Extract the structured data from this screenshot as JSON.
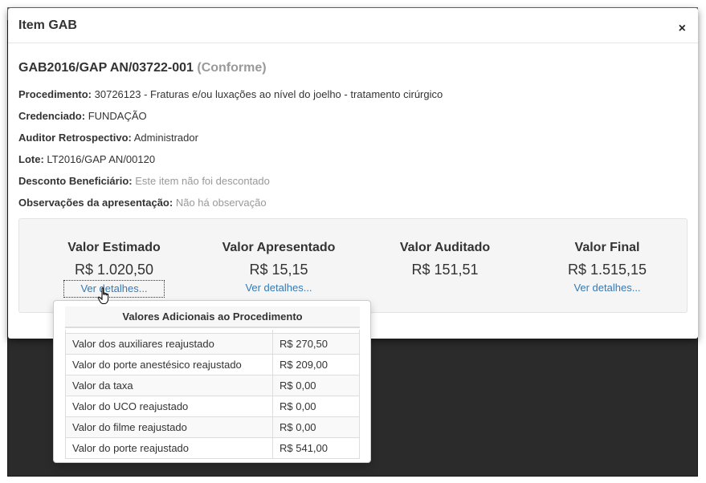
{
  "modal": {
    "title": "Item GAB",
    "close_glyph": "×"
  },
  "item": {
    "code": "GAB2016/GAP AN/03722-001",
    "status": "(Conforme)"
  },
  "fields": [
    {
      "label": "Procedimento:",
      "value": "30726123 - Fraturas e/ou luxações ao nível do joelho - tratamento cirúrgico",
      "muted": false
    },
    {
      "label": "Credenciado:",
      "value": "FUNDAÇÃO",
      "muted": false
    },
    {
      "label": "Auditor Retrospectivo:",
      "value": "Administrador",
      "muted": false
    },
    {
      "label": "Lote:",
      "value": "LT2016/GAP AN/00120",
      "muted": false
    },
    {
      "label": "Desconto Beneficiário:",
      "value": "Este item não foi descontado",
      "muted": true
    },
    {
      "label": "Observações da apresentação:",
      "value": "Não há observação",
      "muted": true
    }
  ],
  "values": [
    {
      "label": "Valor Estimado",
      "amount": "R$ 1.020,50",
      "link": "Ver detalhes..."
    },
    {
      "label": "Valor Apresentado",
      "amount": "R$ 15,15",
      "link": "Ver detalhes..."
    },
    {
      "label": "Valor Auditado",
      "amount": "R$ 151,51",
      "link": ""
    },
    {
      "label": "Valor Final",
      "amount": "R$ 1.515,15",
      "link": "Ver detalhes..."
    }
  ],
  "popover": {
    "title": "Valores Adicionais ao Procedimento",
    "rows": [
      {
        "name": "Valor dos auxiliares reajustado",
        "value": "R$ 270,50"
      },
      {
        "name": "Valor do porte anestésico reajustado",
        "value": "R$ 209,00"
      },
      {
        "name": "Valor da taxa",
        "value": "R$ 0,00"
      },
      {
        "name": "Valor do UCO reajustado",
        "value": "R$ 0,00"
      },
      {
        "name": "Valor do filme reajustado",
        "value": "R$ 0,00"
      },
      {
        "name": "Valor do porte reajustado",
        "value": "R$ 541,00"
      }
    ]
  },
  "icons": {
    "close": "close-icon",
    "cursor": "hand-pointer-icon"
  },
  "colors": {
    "link": "#337ab7",
    "muted": "#999999",
    "backdrop": "#2b2b2b"
  }
}
